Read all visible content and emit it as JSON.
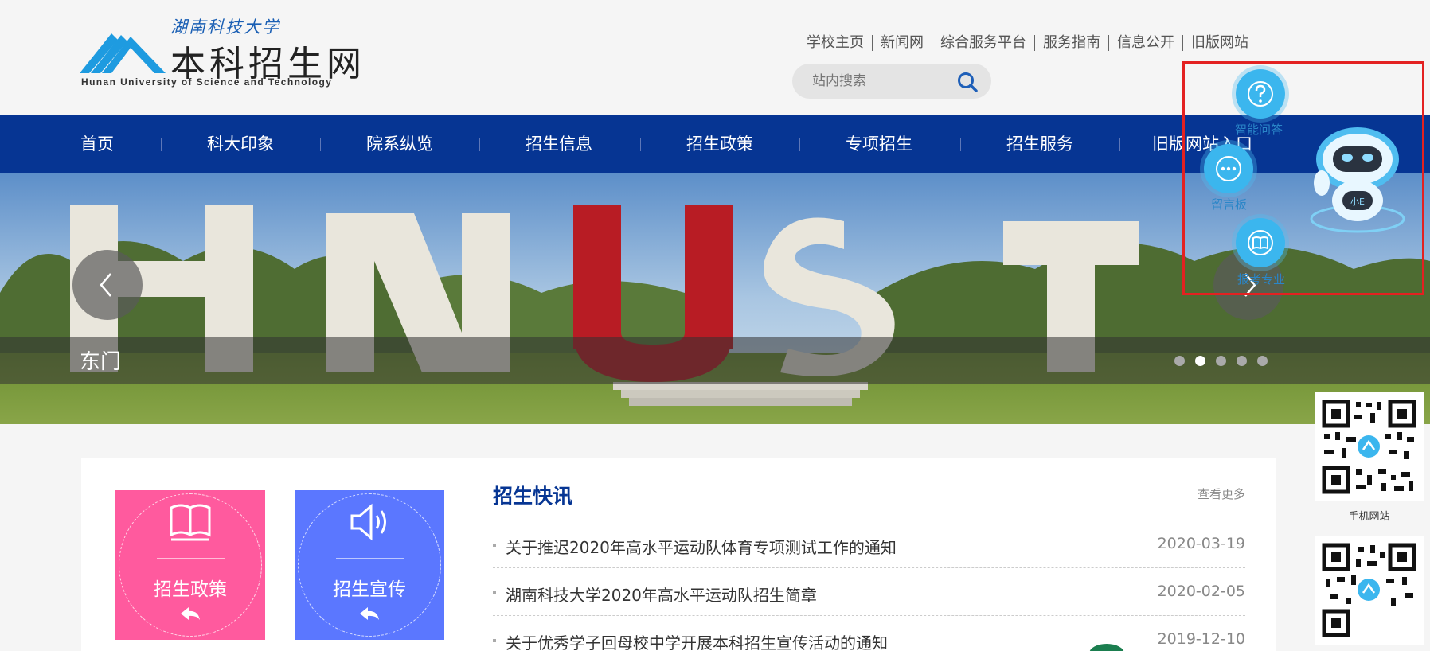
{
  "header": {
    "logo_script": "湖南科技大学",
    "logo_title": "本科招生网",
    "logo_subtitle": "Hunan University of Science and Technology",
    "top_links": [
      "学校主页",
      "新闻网",
      "综合服务平台",
      "服务指南",
      "信息公开",
      "旧版网站"
    ],
    "search_placeholder": "站内搜索"
  },
  "nav": {
    "items": [
      "首页",
      "科大印象",
      "院系纵览",
      "招生信息",
      "招生政策",
      "专项招生",
      "招生服务",
      "旧版网站入口"
    ]
  },
  "banner": {
    "caption": "东门",
    "dots_count": 5,
    "active_dot": 2,
    "sign_letters": [
      "H",
      "N",
      "U",
      "S",
      "T"
    ]
  },
  "tiles": [
    {
      "label": "招生政策",
      "color": "#ff5a9e",
      "icon": "book-icon"
    },
    {
      "label": "招生宣传",
      "color": "#5b77ff",
      "icon": "speaker-icon"
    }
  ],
  "news": {
    "title": "招生快讯",
    "more": "查看更多",
    "items": [
      {
        "title": "关于推迟2020年高水平运动队体育专项测试工作的通知",
        "date": "2020-03-19"
      },
      {
        "title": "湖南科技大学2020年高水平运动队招生简章",
        "date": "2020-02-05"
      },
      {
        "title": "关于优秀学子回母校中学开展本科招生宣传活动的通知",
        "date": "2019-12-10"
      }
    ]
  },
  "floating": {
    "buttons": [
      {
        "label": "智能问答",
        "icon": "question-icon"
      },
      {
        "label": "留言板",
        "icon": "chat-bubble-icon"
      },
      {
        "label": "报考专业",
        "icon": "open-book-icon"
      }
    ],
    "robot_tag": "小E"
  },
  "qrcodes": [
    {
      "label": "手机网站"
    },
    {
      "label": ""
    }
  ],
  "colors": {
    "nav_bg": "#063593",
    "accent_blue": "#1f6cc0",
    "float_highlight": "#e32121"
  }
}
